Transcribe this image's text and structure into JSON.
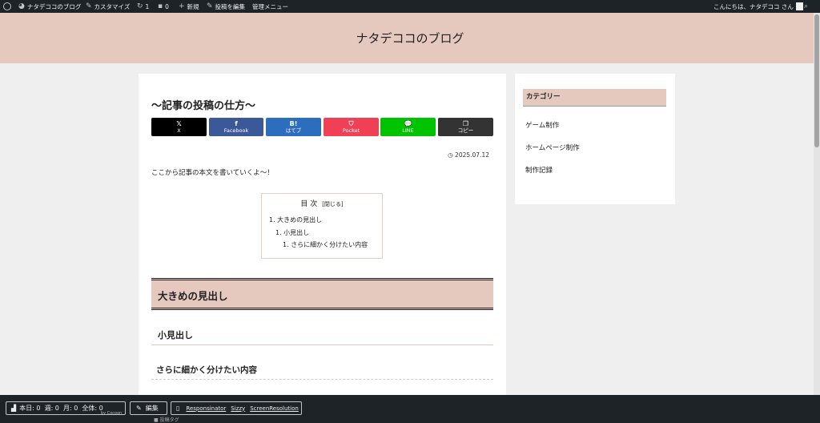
{
  "admin_bar": {
    "site_name": "ナタデココのブログ",
    "customize": "カスタマイズ",
    "updates_count": "1",
    "comments_count": "0",
    "new_label": "新規",
    "edit_post": "投稿を編集",
    "admin_menu": "管理メニュー",
    "greeting": "こんにちは、ナタデココ さん"
  },
  "site": {
    "title": "ナタデココのブログ"
  },
  "post": {
    "title": "〜記事の投稿の仕方〜",
    "date": "2025.07.12",
    "body": "ここから記事の本文を書いていくよ〜！",
    "h2": "大きめの見出し",
    "h3": "小見出し",
    "h4": "さらに細かく分けたい内容"
  },
  "share_buttons": [
    {
      "icon": "𝕏",
      "label": "X",
      "color": "#000000"
    },
    {
      "icon": "f",
      "label": "Facebook",
      "color": "#3b5998"
    },
    {
      "icon": "B!",
      "label": "はてブ",
      "color": "#2c6ebd"
    },
    {
      "icon": "⛉",
      "label": "Pocket",
      "color": "#ef4056"
    },
    {
      "icon": "💬",
      "label": "LINE",
      "color": "#00c300"
    },
    {
      "icon": "❐",
      "label": "コピー",
      "color": "#333333"
    }
  ],
  "toc": {
    "title": "目 次",
    "toggle": "[閉じる]",
    "items": [
      "1. 大きめの見出し",
      "1. 小見出し",
      "1. さらに細かく分けたい内容"
    ]
  },
  "sidebar": {
    "category_title": "カテゴリー",
    "categories": [
      "ゲーム制作",
      "ホームページ制作",
      "制作記録"
    ]
  },
  "bottom_bar": {
    "stats": "本日: 0  週: 0  月: 0  全体: 0",
    "by": "by Cocoon",
    "edit": "編集",
    "links": [
      "Responsinator",
      "Sizzy",
      "ScreenResolution"
    ],
    "cut_text": "■ 投稿タグ"
  },
  "colors": {
    "accent": "#e5c8be",
    "admin_bar": "#1d2327"
  }
}
